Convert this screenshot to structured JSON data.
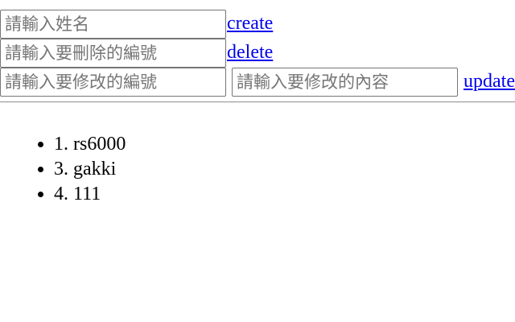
{
  "form": {
    "create": {
      "name_placeholder": "請輸入姓名",
      "name_value": "",
      "link_label": "create"
    },
    "delete": {
      "id_placeholder": "請輸入要刪除的編號",
      "id_value": "",
      "link_label": "delete"
    },
    "update": {
      "id_placeholder": "請輸入要修改的編號",
      "id_value": "",
      "content_placeholder": "請輸入要修改的內容",
      "content_value": "",
      "link_label": "update"
    }
  },
  "list": {
    "items": [
      {
        "text": "1. rs6000"
      },
      {
        "text": "3. gakki"
      },
      {
        "text": "4. 111"
      }
    ]
  },
  "colors": {
    "link": "#0000ee",
    "placeholder": "#757575",
    "input_border": "#767676"
  }
}
